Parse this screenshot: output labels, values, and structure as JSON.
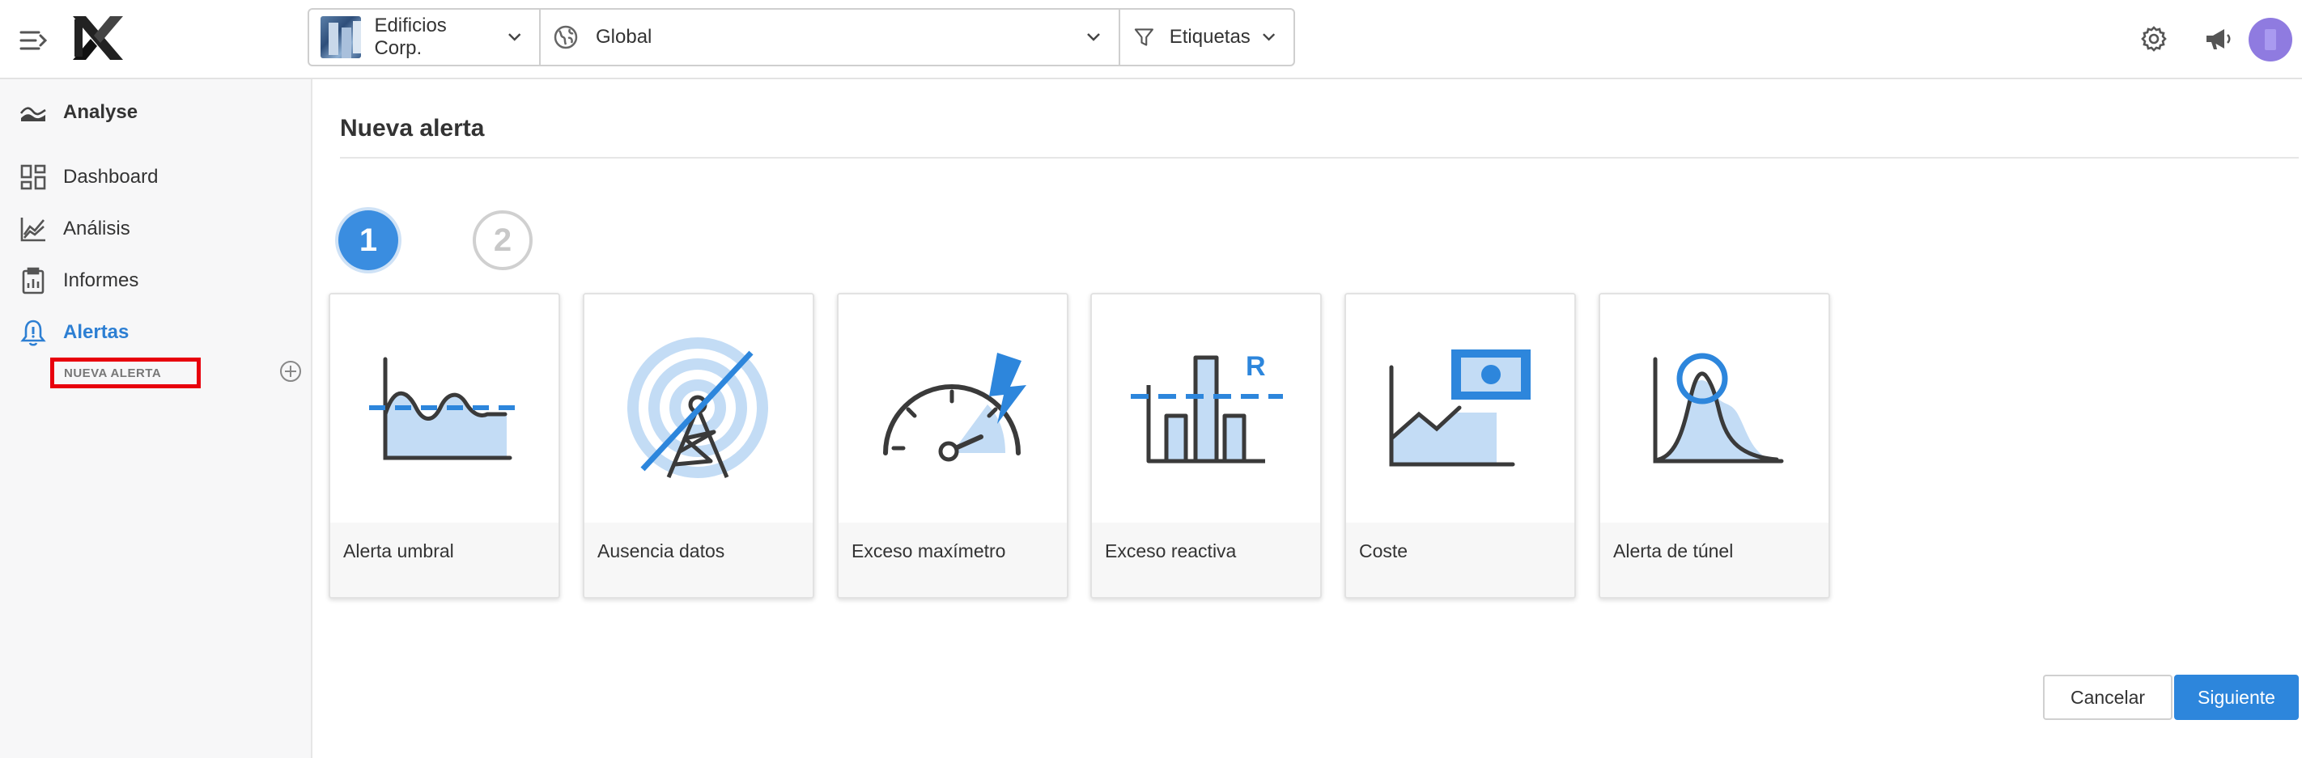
{
  "header": {
    "company": "Edificios Corp.",
    "region": "Global",
    "tags": "Etiquetas"
  },
  "sidebar": {
    "section": "Analyse",
    "items": [
      {
        "label": "Dashboard",
        "icon": "dashboard-icon"
      },
      {
        "label": "Análisis",
        "icon": "chart-line-icon"
      },
      {
        "label": "Informes",
        "icon": "clipboard-icon"
      },
      {
        "label": "Alertas",
        "icon": "bell-icon",
        "active": true
      }
    ],
    "sub_item": "NUEVA ALERTA"
  },
  "main": {
    "title": "Nueva alerta",
    "steps": [
      "1",
      "2"
    ],
    "active_step": 1,
    "cards": [
      {
        "label": "Alerta umbral",
        "icon": "threshold-chart-icon"
      },
      {
        "label": "Ausencia datos",
        "icon": "antenna-no-signal-icon"
      },
      {
        "label": "Exceso maxímetro",
        "icon": "gauge-lightning-icon"
      },
      {
        "label": "Exceso reactiva",
        "icon": "reactive-bars-icon"
      },
      {
        "label": "Coste",
        "icon": "cost-banknote-icon"
      },
      {
        "label": "Alerta de túnel",
        "icon": "tunnel-curve-icon"
      }
    ],
    "r_letter": "R"
  },
  "actions": {
    "cancel": "Cancelar",
    "next": "Siguiente"
  },
  "colors": {
    "accent": "#2d86dc",
    "icon_fill": "#c3dcf5",
    "highlight": "#e8000d"
  }
}
